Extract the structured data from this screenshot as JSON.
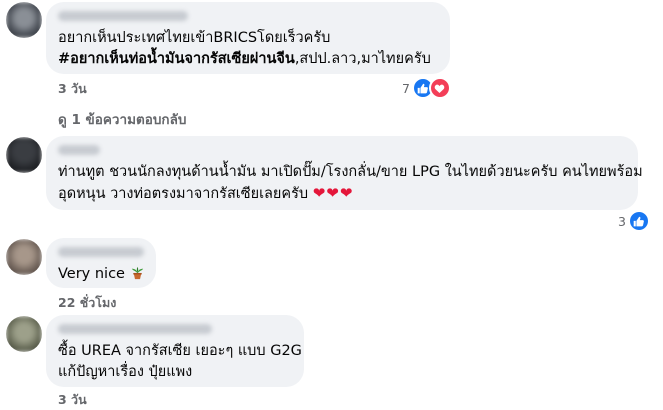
{
  "comments": [
    {
      "lines": [
        {
          "text": "อยากเห็นประเทศไทยเข้าBRICSโดยเร็วครับ",
          "parts": null
        },
        {
          "parts": [
            {
              "text": "#อยากเห็นท่อน้ำมันจากรัสเซียผ่านจีน",
              "bold": true
            },
            {
              "text": ",สปป.ลาว,มาไทยครับ",
              "bold": false
            }
          ]
        }
      ],
      "time": "3 วัน",
      "reaction_count": "7",
      "reactions": [
        "like-icon",
        "love-icon"
      ]
    },
    {
      "lines": [
        "ท่านทูต ชวนนักลงทุนด้านน้ำมัน มาเปิดปั๊ม/โรงกลั่น/ขาย LPG ในไทยด้วยนะครับ คนไทยพร้อม",
        "อุดหนุน วางท่อตรงมาจากรัสเซียเลยครับ"
      ],
      "hearts": "❤❤❤",
      "reaction_count": "3",
      "reactions": [
        "like-icon"
      ]
    },
    {
      "lines": [
        "Very nice"
      ],
      "emoji": "potted-plant-icon",
      "time": "22 ชั่วโมง"
    },
    {
      "lines": [
        "ซื้อ UREA จากรัสเซีย เยอะๆ แบบ G2G",
        "แก้ปัญหาเรื่อง ปุ๋ยแพง"
      ],
      "time": "3 วัน"
    }
  ],
  "view_replies": "ดู 1 ข้อความตอบกลับ",
  "colors": {
    "bubble": "#f0f2f5",
    "meta": "#65676b",
    "like": "#1877f2",
    "love": "#f33e58",
    "heart": "#e4163a"
  }
}
